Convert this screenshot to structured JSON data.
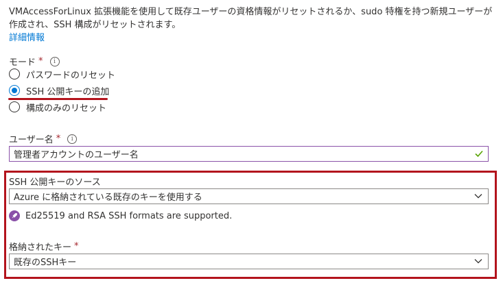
{
  "description": {
    "text": "VMAccessForLinux 拡張機能を使用して既存ユーザーの資格情報がリセットされるか、sudo 特権を持つ新規ユーザーが作成され、SSH 構成がリセットされます。",
    "link": "詳細情報"
  },
  "mode": {
    "label": "モード",
    "required_mark": "*",
    "info_icon": "info-icon",
    "options": [
      {
        "label": "パスワードのリセット",
        "checked": false
      },
      {
        "label": "SSH 公開キーの追加",
        "checked": true
      },
      {
        "label": "構成のみのリセット",
        "checked": false
      }
    ]
  },
  "username": {
    "label": "ユーザー名",
    "required_mark": "*",
    "value": "管理者アカウントのユーザー名"
  },
  "ssh_source": {
    "label": "SSH 公開キーのソース",
    "value": "Azure に格納されている既存のキーを使用する",
    "info_message": "Ed25519 and RSA SSH formats are supported."
  },
  "stored_key": {
    "label": "格納されたキー",
    "required_mark": "*",
    "value": "既存のSSHキー"
  },
  "colors": {
    "accent": "#0078d4",
    "highlight": "#b3131c",
    "valid_border": "#8a51a8",
    "check": "#57a300"
  }
}
